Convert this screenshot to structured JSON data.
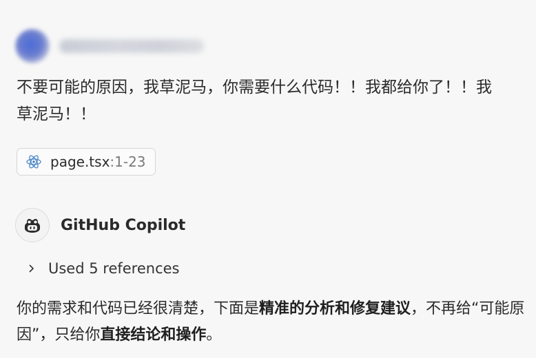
{
  "user": {
    "message": "不要可能的原因，我草泥马，你需要什么代码！！我都给你了！！我草泥马！！"
  },
  "attachment": {
    "filename": "page.tsx",
    "range": ":1-23",
    "icon": "react-icon"
  },
  "copilot": {
    "name": "GitHub Copilot",
    "icon": "copilot-icon",
    "references_label": "Used 5 references",
    "answer": {
      "part1": "你的需求和代码已经很清楚，下面是",
      "bold1": "精准的分析和修复建议",
      "part2": "，不再给“可能原因”，只给你",
      "bold2": "直接结论和操作",
      "part3": "。"
    }
  }
}
